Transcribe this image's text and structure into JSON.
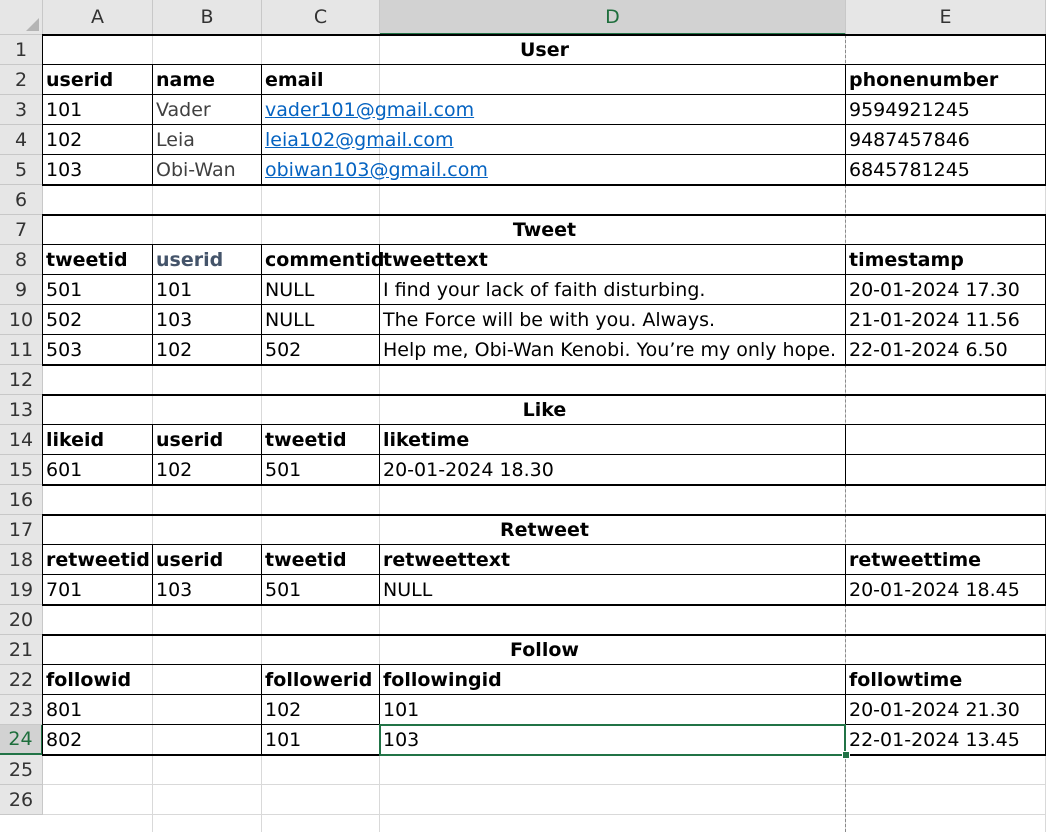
{
  "columns": [
    "A",
    "B",
    "C",
    "D",
    "E"
  ],
  "rows": [
    "1",
    "2",
    "3",
    "4",
    "5",
    "6",
    "7",
    "8",
    "9",
    "10",
    "11",
    "12",
    "13",
    "14",
    "15",
    "16",
    "17",
    "18",
    "19",
    "20",
    "21",
    "22",
    "23",
    "24",
    "25",
    "26"
  ],
  "selection": {
    "column": "D",
    "row": "24"
  },
  "tables": {
    "user": {
      "title": "User",
      "headers": [
        "userid",
        "name",
        "email",
        "phonenumber"
      ],
      "rows": [
        [
          "101",
          "Vader",
          "vader101@gmail.com",
          "9594921245"
        ],
        [
          "102",
          "Leia",
          "leia102@gmail.com",
          "9487457846"
        ],
        [
          "103",
          "Obi-Wan",
          "obiwan103@gmail.com",
          "6845781245"
        ]
      ]
    },
    "tweet": {
      "title": "Tweet",
      "headers": [
        "tweetid",
        "userid",
        "commentid",
        "tweettext",
        "timestamp"
      ],
      "rows": [
        [
          "501",
          "101",
          "NULL",
          "I find your lack of faith disturbing.",
          "20-01-2024 17.30"
        ],
        [
          "502",
          "103",
          "NULL",
          "The Force will be with you. Always.",
          "21-01-2024 11.56"
        ],
        [
          "503",
          "102",
          "502",
          "Help me, Obi-Wan Kenobi. You’re my only hope.",
          "22-01-2024 6.50"
        ]
      ]
    },
    "like": {
      "title": "Like",
      "headers": [
        "likeid",
        "userid",
        "tweetid",
        "liketime"
      ],
      "rows": [
        [
          "601",
          "102",
          "501",
          "20-01-2024 18.30"
        ]
      ]
    },
    "retweet": {
      "title": "Retweet",
      "headers": [
        "retweetid",
        "userid",
        "tweetid",
        "retweettext",
        "retweettime"
      ],
      "rows": [
        [
          "701",
          "103",
          "501",
          "NULL",
          "20-01-2024 18.45"
        ]
      ]
    },
    "follow": {
      "title": "Follow",
      "headers": [
        "followid",
        "followerid",
        "followingid",
        "followtime"
      ],
      "rows": [
        [
          "801",
          "102",
          "101",
          "20-01-2024 21.30"
        ],
        [
          "802",
          "101",
          "103",
          "22-01-2024 13.45"
        ]
      ]
    }
  }
}
